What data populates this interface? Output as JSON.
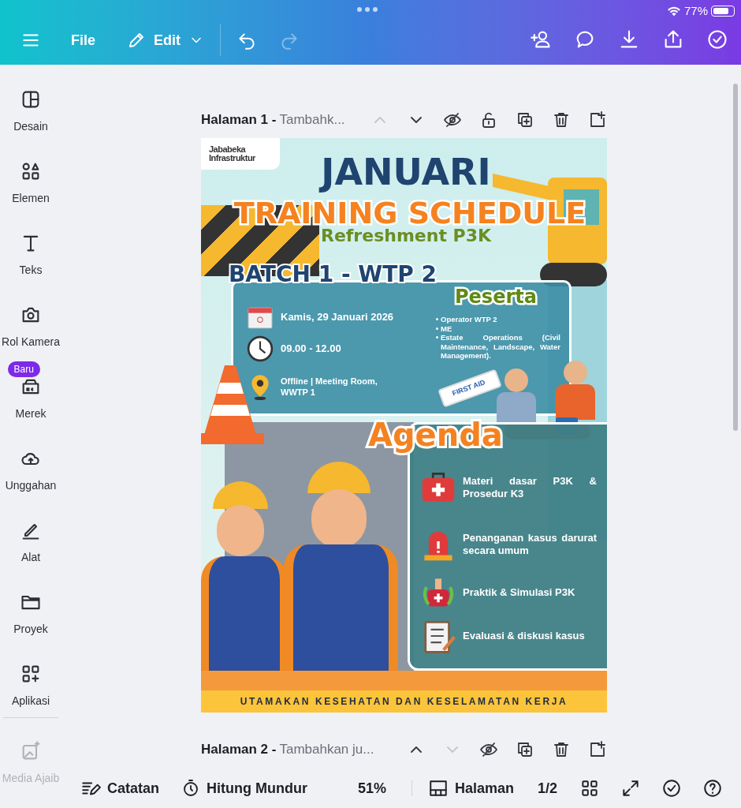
{
  "status_bar": {
    "battery": "77%"
  },
  "toolbar": {
    "file": "File",
    "edit": "Edit",
    "undo_disabled": false,
    "redo_disabled": true
  },
  "sidebar": {
    "items": [
      {
        "kind": "design",
        "label": "Desain",
        "faded": false
      },
      {
        "kind": "elements",
        "label": "Elemen",
        "faded": false
      },
      {
        "kind": "text",
        "label": "Teks",
        "faded": false
      },
      {
        "kind": "camera",
        "label": "Rol Kamera",
        "faded": false
      },
      {
        "kind": "brand",
        "label": "Merek",
        "badge": "Baru",
        "faded": false
      },
      {
        "kind": "upload",
        "label": "Unggahan",
        "faded": false
      },
      {
        "kind": "draw",
        "label": "Alat",
        "faded": false
      },
      {
        "kind": "folder",
        "label": "Proyek",
        "faded": false
      },
      {
        "kind": "apps",
        "label": "Aplikasi",
        "faded": false
      },
      {
        "kind": "magic",
        "label": "Media Ajaib",
        "faded": true
      }
    ]
  },
  "pages": [
    {
      "title": "Halaman 1 -",
      "subtitle": "Tambahk...",
      "up_disabled": true,
      "down_disabled": false,
      "lock_shown": true
    },
    {
      "title": "Halaman 2 -",
      "subtitle": "Tambahkan ju...",
      "up_disabled": false,
      "down_disabled": true,
      "lock_shown": false
    }
  ],
  "poster": {
    "logo": [
      "Jababeka",
      "Infrastruktur"
    ],
    "title": "JANUARI",
    "headline": "TRAINING SCHEDULE",
    "subtitle": "Refreshment P3K",
    "batch": "BATCH 1 - WTP 2",
    "info": [
      {
        "kind": "date",
        "text": "Kamis, 29 Januari 2026"
      },
      {
        "kind": "time",
        "text": "09.00 - 12.00"
      },
      {
        "kind": "location",
        "text": "Offline | Meeting Room, WWTP 1"
      }
    ],
    "participants_heading": "Peserta",
    "participants": [
      "Operator WTP 2",
      "ME",
      "Estate Operations (Civil Maintenance, Landscape, Water Management)."
    ],
    "tube_label": "FIRST AID",
    "agenda_heading": "Agenda",
    "agenda": [
      {
        "kind": "kit",
        "text": "Materi dasar P3K & Prosedur K3"
      },
      {
        "kind": "siren",
        "text": "Penanganan kasus darurat secara umum"
      },
      {
        "kind": "practice",
        "text": "Praktik & Simulasi P3K"
      },
      {
        "kind": "clipboard",
        "text": "Evaluasi & diskusi kasus"
      }
    ],
    "footer": "UTAMAKAN KESEHATAN DAN KESELAMATAN KERJA"
  },
  "bottom_bar": {
    "notes": "Catatan",
    "timer": "Hitung Mundur",
    "zoom": "51%",
    "pages": "Halaman",
    "page_count": "1/2"
  }
}
